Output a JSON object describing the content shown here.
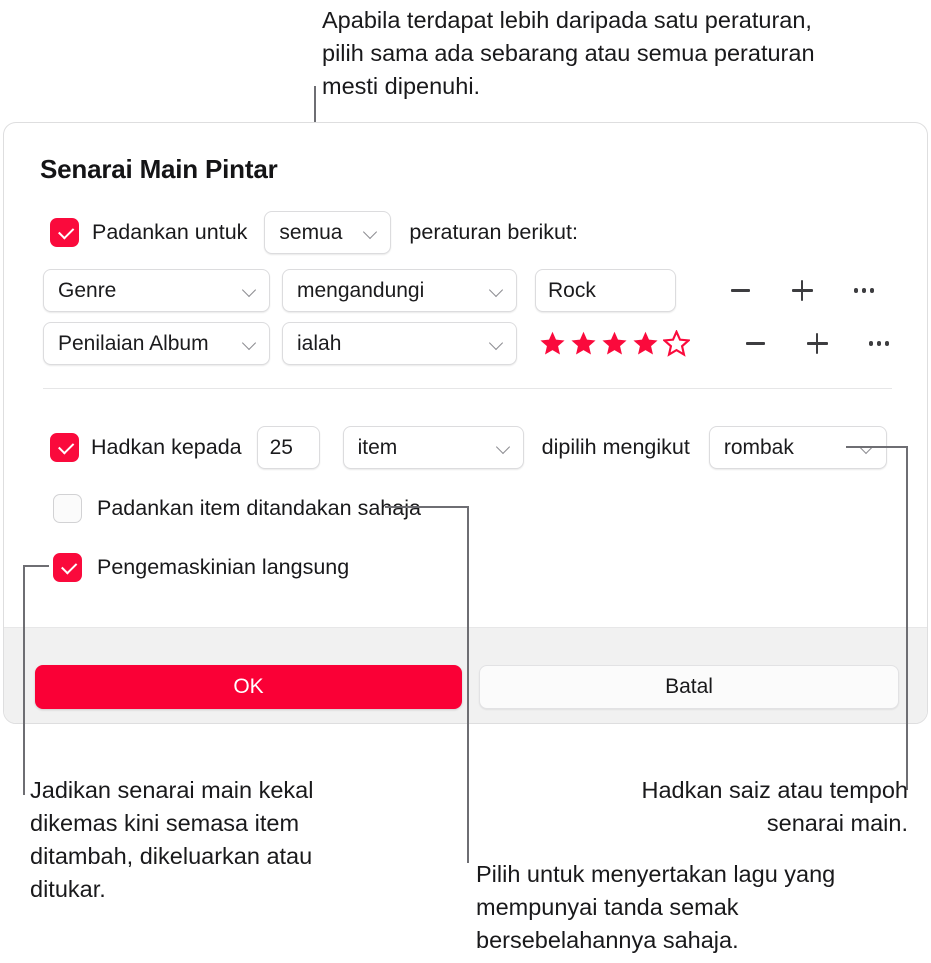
{
  "annotations": {
    "top": "Apabila terdapat lebih daripada satu peraturan, pilih sama ada sebarang atau semua peraturan mesti dipenuhi.",
    "left": "Jadikan senarai main kekal dikemas kini semasa item ditambah, dikeluarkan atau ditukar.",
    "right": "Hadkan saiz atau tempoh senarai main.",
    "middle": "Pilih untuk menyertakan lagu yang mempunyai tanda semak bersebelahannya sahaja."
  },
  "dialog": {
    "title": "Senarai Main Pintar",
    "match": {
      "checkbox_checked": true,
      "label_before": "Padankan untuk",
      "scope_value": "semua",
      "label_after": "peraturan berikut:"
    },
    "rules": [
      {
        "field": "Genre",
        "operator": "mengandungi",
        "value_type": "text",
        "value": "Rock",
        "remove_label": "remove-rule",
        "add_label": "add-rule",
        "more_label": "more-options"
      },
      {
        "field": "Penilaian Album",
        "operator": "ialah",
        "value_type": "stars",
        "stars_filled": 4,
        "stars_total": 5,
        "remove_label": "remove-rule",
        "add_label": "add-rule",
        "more_label": "more-options"
      }
    ],
    "limit": {
      "checkbox_checked": true,
      "label": "Hadkan kepada",
      "amount": "25",
      "unit": "item",
      "label_middle": "dipilih mengikut",
      "order": "rombak"
    },
    "match_checked_only": {
      "checkbox_checked": false,
      "label": "Padankan item ditandakan sahaja"
    },
    "live_updating": {
      "checkbox_checked": true,
      "label": "Pengemaskinian langsung"
    },
    "buttons": {
      "ok": "OK",
      "cancel": "Batal"
    }
  },
  "colors": {
    "accent_red": "#FA0A3C",
    "ok_button": "#FA0036",
    "star_red": "#FA0A3C",
    "text": "#19191B",
    "footer_bg": "#F1F1F1"
  }
}
